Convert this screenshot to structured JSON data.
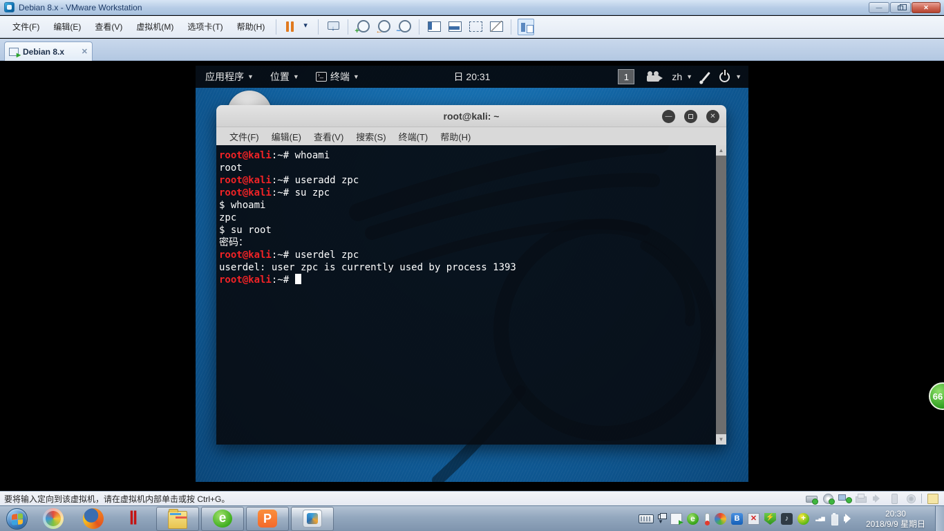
{
  "vmware": {
    "title": "Debian 8.x - VMware Workstation",
    "window_buttons": [
      "minimize",
      "restore",
      "close"
    ],
    "menu": [
      "文件(F)",
      "编辑(E)",
      "查看(V)",
      "虚拟机(M)",
      "选项卡(T)",
      "帮助(H)"
    ],
    "toolbar_icons": [
      "pause",
      "dropdown",
      "sep",
      "send-cad",
      "sep",
      "snapshot-take",
      "snapshot-revert",
      "snapshot-manage",
      "sep",
      "console-left",
      "console-bottom",
      "fullscreen",
      "unity-off",
      "sep",
      "library"
    ],
    "tab_label": "Debian 8.x",
    "tab_close": "✕",
    "status_message": "要将输入定向到该虚拟机，请在虚拟机内部单击或按 Ctrl+G。",
    "status_device_icons": [
      "hdd",
      "cdrom",
      "network",
      "printer",
      "sound",
      "usb",
      "webcam",
      "sep",
      "message"
    ]
  },
  "kali_panel": {
    "applications_label": "应用程序",
    "places_label": "位置",
    "terminal_label": "终端",
    "clock": "日 20:31",
    "workspace": "1",
    "keyboard_layout": "zh",
    "right_icons": [
      "camera",
      "brush",
      "power"
    ]
  },
  "terminal": {
    "title": "root@kali: ~",
    "window_buttons": [
      "minimize",
      "maximize",
      "close"
    ],
    "menu": [
      "文件(F)",
      "编辑(E)",
      "查看(V)",
      "搜索(S)",
      "终端(T)",
      "帮助(H)"
    ],
    "lines": [
      {
        "seg": [
          [
            "root@kali",
            "p"
          ],
          [
            ":~# whoami",
            ""
          ]
        ]
      },
      {
        "seg": [
          [
            "root",
            ""
          ]
        ]
      },
      {
        "seg": [
          [
            "root@kali",
            "p"
          ],
          [
            ":~# useradd zpc",
            ""
          ]
        ]
      },
      {
        "seg": [
          [
            "root@kali",
            "p"
          ],
          [
            ":~# su zpc",
            ""
          ]
        ]
      },
      {
        "seg": [
          [
            "$ whoami",
            ""
          ]
        ]
      },
      {
        "seg": [
          [
            "zpc",
            ""
          ]
        ]
      },
      {
        "seg": [
          [
            "$ su root",
            ""
          ]
        ]
      },
      {
        "seg": [
          [
            "密码：",
            ""
          ]
        ]
      },
      {
        "seg": [
          [
            "root@kali",
            "p"
          ],
          [
            ":~# userdel zpc",
            ""
          ]
        ]
      },
      {
        "seg": [
          [
            "userdel: user zpc is currently used by process 1393",
            ""
          ]
        ]
      },
      {
        "seg": [
          [
            "root@kali",
            "p"
          ],
          [
            ":~# ",
            ""
          ]
        ],
        "cursor": true
      }
    ]
  },
  "taskbar": {
    "left_icons": [
      "start",
      "swirl",
      "firefox",
      "red-app"
    ],
    "app_buttons": [
      {
        "name": "explorer",
        "active": false
      },
      {
        "name": "browser-360",
        "active": false,
        "glyph": "e"
      },
      {
        "name": "wps",
        "active": false,
        "glyph": "P"
      },
      {
        "name": "vmware",
        "active": true
      }
    ],
    "tray_icons": [
      "vmware-tray",
      "browser-360",
      "temperature",
      "pinwheel",
      "bluetooth",
      "network-error",
      "shield",
      "music",
      "safety-ball",
      "signal",
      "battery",
      "volume"
    ],
    "tray_glyphs": {
      "browser-360": "e",
      "bluetooth": "B",
      "shield": "⚡",
      "music": "♪",
      "safety-ball": "+",
      "signal": "▂▄▆"
    },
    "clock_time": "20:30",
    "clock_date": "2018/9/9 星期日"
  },
  "accelerator_ball_value": "66",
  "colors": {
    "prompt_red": "#ef2326",
    "terminal_bg": "#070c12",
    "desktop_blue": "#11609e",
    "titlebar_blue": "#b6cce6",
    "taskbar_blue": "#93a7be"
  }
}
